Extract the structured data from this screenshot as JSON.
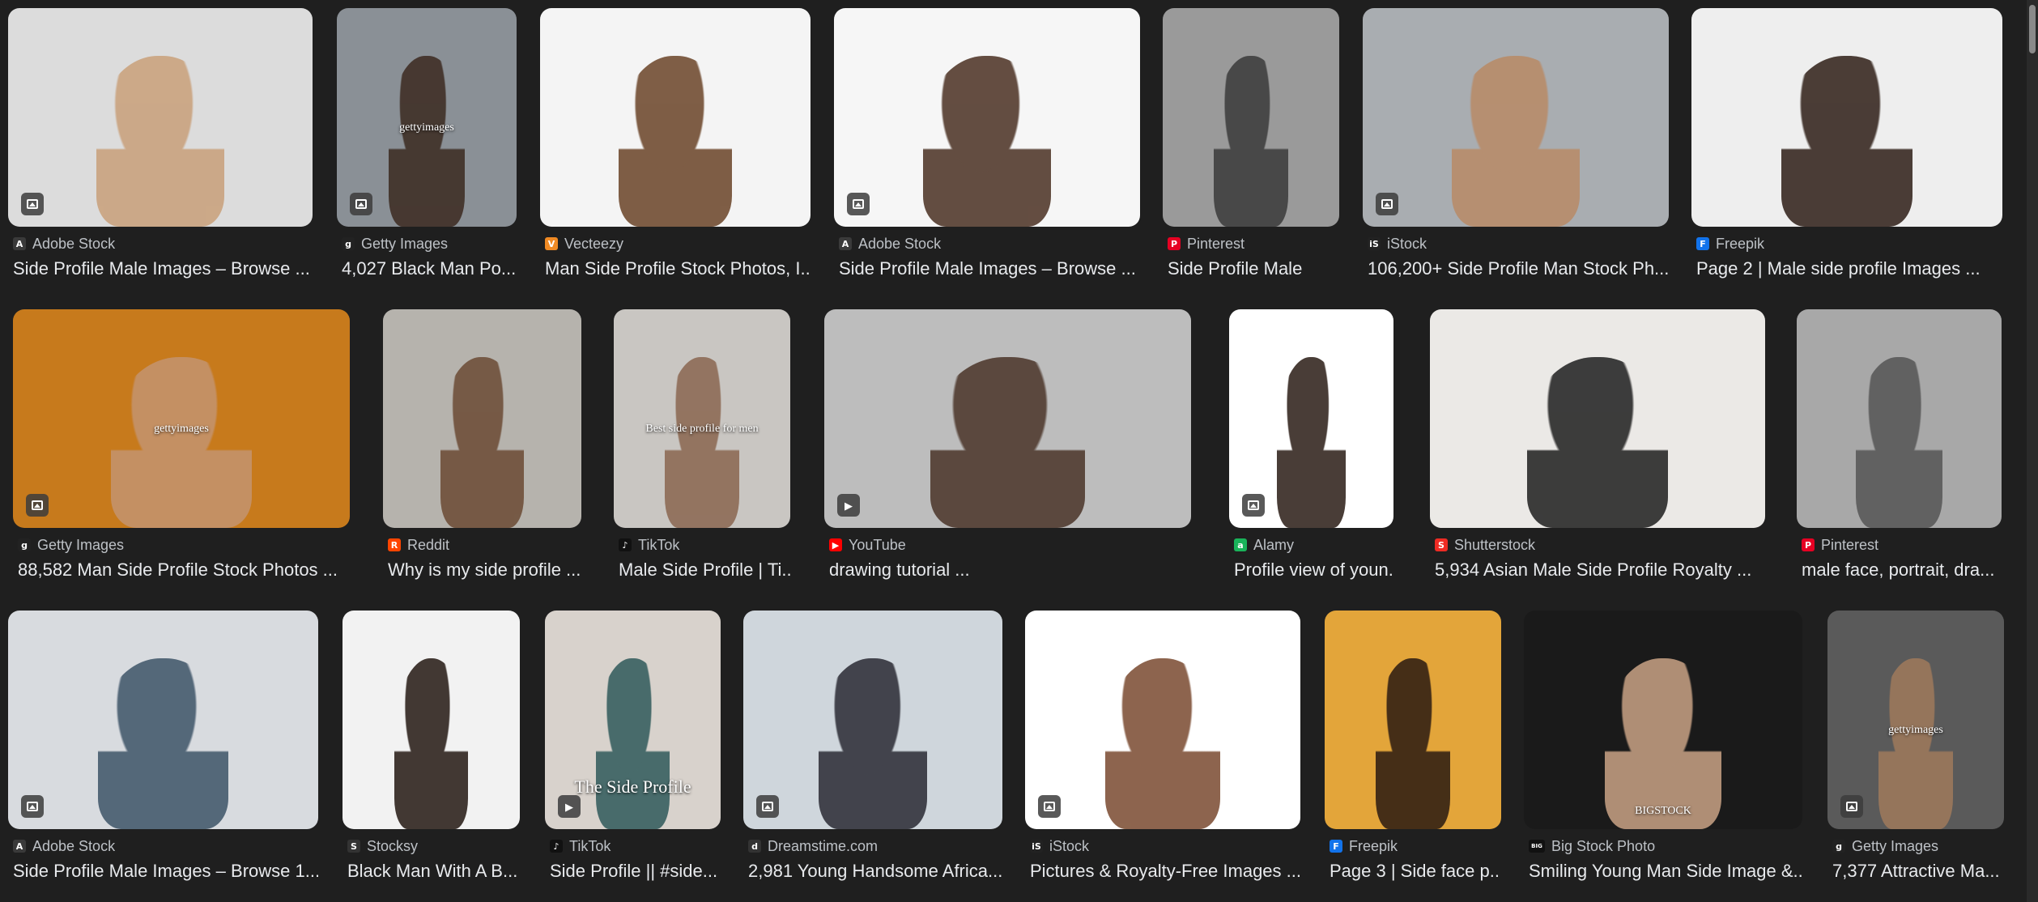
{
  "results": [
    {
      "source": "Adobe Stock",
      "title": "Side Profile Male Images – Browse ...",
      "favicon": "A",
      "fav_color": "#3a3a3a",
      "bg": "#dcdcdc",
      "fig": "#c9a07a",
      "badge": "image-icon"
    },
    {
      "source": "Getty Images",
      "title": "4,027 Black Man Po...",
      "favicon": "g",
      "fav_color": "#222222",
      "bg": "#8a9096",
      "fig": "#3b2a20",
      "badge": "image-icon",
      "overlay": "gettyimages"
    },
    {
      "source": "Vecteezy",
      "title": "Man Side Profile Stock Photos, I...",
      "favicon": "V",
      "fav_color": "#f08a24",
      "bg": "#f4f4f4",
      "fig": "#6a4327"
    },
    {
      "source": "Adobe Stock",
      "title": "Side Profile Male Images – Browse ...",
      "favicon": "A",
      "fav_color": "#3a3a3a",
      "bg": "#f6f6f6",
      "fig": "#4a3022",
      "badge": "image-icon"
    },
    {
      "source": "Pinterest",
      "title": "Side Profile Male",
      "favicon": "P",
      "fav_color": "#e60023",
      "bg": "#9a9a9a",
      "fig": "#3a3a3a"
    },
    {
      "source": "iStock",
      "title": "106,200+ Side Profile Man Stock Ph...",
      "favicon": "iS",
      "fav_color": "#222222",
      "bg": "#a9adb1",
      "fig": "#b98a66",
      "badge": "image-icon"
    },
    {
      "source": "Freepik",
      "title": "Page 2 | Male side profile Images ...",
      "favicon": "F",
      "fav_color": "#1273eb",
      "bg": "#eeeeee",
      "fig": "#2e1e16"
    },
    {
      "source": "Getty Images",
      "title": "88,582 Man Side Profile Stock Photos ...",
      "favicon": "g",
      "fav_color": "#222222",
      "bg": "#c77a1c",
      "fig": "#c49470",
      "badge": "image-icon",
      "overlay": "gettyimages"
    },
    {
      "source": "Reddit",
      "title": "Why is my side profile ...",
      "favicon": "R",
      "fav_color": "#ff4500",
      "bg": "#b6b3ad",
      "fig": "#6b4a34"
    },
    {
      "source": "TikTok",
      "title": "Male Side Profile | Ti...",
      "favicon": "♪",
      "fav_color": "#111111",
      "bg": "#c9c6c2",
      "fig": "#8a6650",
      "overlay": "Best side profile for men"
    },
    {
      "source": "YouTube",
      "title": "drawing tutorial ...",
      "favicon": "▶",
      "fav_color": "#ff0000",
      "bg": "#bdbdbd",
      "fig": "#4a3428",
      "badge": "play-icon"
    },
    {
      "source": "Alamy",
      "title": "Profile view of youn...",
      "favicon": "a",
      "fav_color": "#19b35a",
      "bg": "#ffffff",
      "fig": "#2a1c15",
      "badge": "image-icon"
    },
    {
      "source": "Shutterstock",
      "title": "5,934 Asian Male Side Profile Royalty ...",
      "favicon": "S",
      "fav_color": "#ee2b24",
      "bg": "#ebe9e6",
      "fig": "#1e1e1e"
    },
    {
      "source": "Pinterest",
      "title": "male face, portrait, dra...",
      "favicon": "P",
      "fav_color": "#e60023",
      "bg": "#a8a8a8",
      "fig": "#555555"
    },
    {
      "source": "Adobe Stock",
      "title": "Side Profile Male Images – Browse 1...",
      "favicon": "A",
      "fav_color": "#3a3a3a",
      "bg": "#d8dbdf",
      "fig": "#3e5468",
      "badge": "image-icon"
    },
    {
      "source": "Stocksy",
      "title": "Black Man With A B...",
      "favicon": "S",
      "fav_color": "#333333",
      "bg": "#f2f2f2",
      "fig": "#241812"
    },
    {
      "source": "TikTok",
      "title": "Side Profile || #side...",
      "favicon": "♪",
      "fav_color": "#111111",
      "bg": "#d8d2cc",
      "fig": "#2f5a5a",
      "badge": "play-icon",
      "overlay": "The Side Profile"
    },
    {
      "source": "Dreamstime.com",
      "title": "2,981 Young Handsome Africa...",
      "favicon": "d",
      "fav_color": "#333333",
      "bg": "#cfd6dc",
      "fig": "#2a2a33",
      "badge": "image-icon"
    },
    {
      "source": "iStock",
      "title": "Pictures & Royalty-Free Images ...",
      "favicon": "iS",
      "fav_color": "#222222",
      "bg": "#ffffff",
      "fig": "#7a4a30",
      "badge": "image-icon"
    },
    {
      "source": "Freepik",
      "title": "Page 3 | Side face p...",
      "favicon": "F",
      "fav_color": "#1273eb",
      "bg": "#e3a53a",
      "fig": "#2a1a12"
    },
    {
      "source": "Big Stock Photo",
      "title": "Smiling Young Man Side Image &...",
      "favicon": "BIG",
      "fav_color": "#111111",
      "bg": "#1a1a1a",
      "fig": "#c9a386",
      "overlay": "BIGSTOCK"
    },
    {
      "source": "Getty Images",
      "title": "7,377 Attractive Ma...",
      "favicon": "g",
      "fav_color": "#222222",
      "bg": "#5a5a5a",
      "fig": "#a07a5c",
      "badge": "image-icon",
      "overlay": "gettyimages"
    }
  ]
}
